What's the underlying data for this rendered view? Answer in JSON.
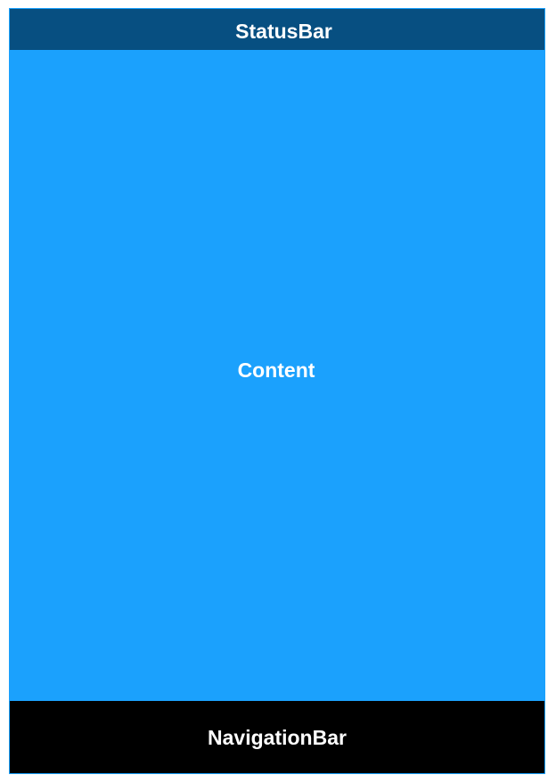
{
  "status_bar": {
    "label": "StatusBar",
    "background": "#074f81"
  },
  "content": {
    "label": "Content",
    "background": "#1ba1fd"
  },
  "navigation_bar": {
    "label": "NavigationBar",
    "background": "#000000"
  },
  "colors": {
    "frame_border": "#1ba1fd",
    "text": "#ffffff"
  }
}
